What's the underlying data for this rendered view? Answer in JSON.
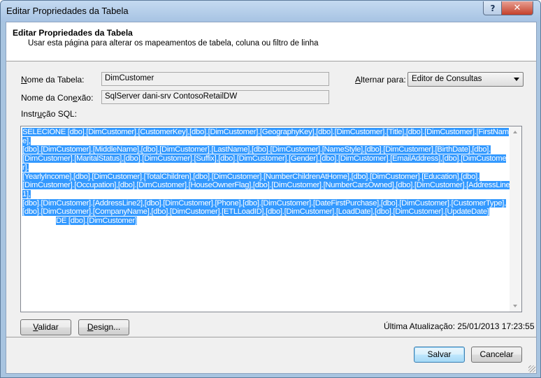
{
  "window": {
    "title": "Editar Propriedades da Tabela",
    "help_glyph": "?",
    "close_glyph": "✕"
  },
  "header": {
    "title": "Editar Propriedades da Tabela",
    "subtitle": "Usar esta página para alterar os mapeamentos de tabela, coluna ou filtro de linha"
  },
  "form": {
    "table_name_label_mnemonic": "N",
    "table_name_label_rest": "ome da Tabela:",
    "table_name_value": "DimCustomer",
    "connection_label_pre": "Nome da Con",
    "connection_label_mnemonic": "e",
    "connection_label_post": "xão:",
    "connection_value": "SqlServer dani-srv ContosoRetailDW",
    "toggle_label_mnemonic": "A",
    "toggle_label_rest": "lternar para:",
    "toggle_selected": "Editor de Consultas",
    "sql_label_pre": "Instr",
    "sql_label_mnemonic": "u",
    "sql_label_post": "ção SQL:"
  },
  "sql": {
    "lines": [
      "SELECIONE [dbo].[DimCustomer].[CustomerKey],[dbo].[DimCustomer].[GeographyKey],[dbo].[DimCustomer].[Title],[dbo].[DimCustomer].[FirstName],",
      "[dbo].[DimCustomer].[MiddleName],[dbo].[DimCustomer].[LastName],[dbo].[DimCustomer].[NameStyle],[dbo].[DimCustomer].[BirthDate],[dbo].",
      "[DimCustomer].[MaritalStatus],[dbo].[DimCustomer].[Suffix],[dbo].[DimCustomer].[Gender],[dbo].[DimCustomer].[EmailAddress],[dbo].[DimCustomer].",
      "[YearlyIncome],[dbo].[DimCustomer].[TotalChildren],[dbo].[DimCustomer].[NumberChildrenAtHome],[dbo].[DimCustomer].[Education],[dbo].",
      "[DimCustomer].[Occupation],[dbo].[DimCustomer].[HouseOwnerFlag],[dbo].[DimCustomer].[NumberCarsOwned],[dbo].[DimCustomer].[AddressLine1],",
      "[dbo].[DimCustomer].[AddressLine2],[dbo].[DimCustomer].[Phone],[dbo].[DimCustomer].[DateFirstPurchase],[dbo].[DimCustomer].[CustomerType],",
      "[dbo].[DimCustomer].[CompanyName],[dbo].[DimCustomer].[ETLLoadID],[dbo].[DimCustomer].[LoadDate],[dbo].[DimCustomer].[UpdateDate]",
      "DE [dbo].[DimCustomer]"
    ]
  },
  "buttons": {
    "validate_mnemonic": "V",
    "validate_rest": "alidar",
    "design_mnemonic": "D",
    "design_rest": "esign...",
    "save": "Salvar",
    "cancel": "Cancelar"
  },
  "status": {
    "last_update_label": "Última Atualização:",
    "last_update_value": "25/01/2013 17:23:55"
  }
}
